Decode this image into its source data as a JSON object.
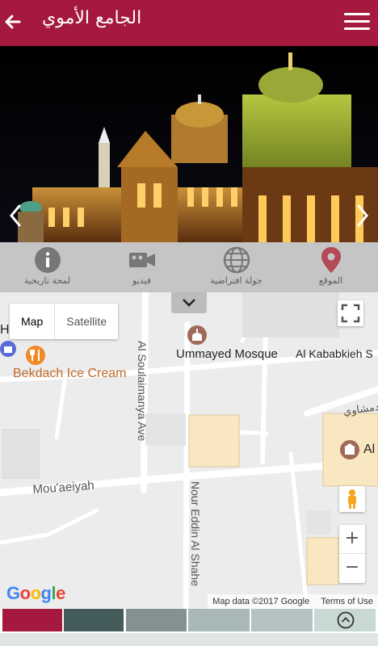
{
  "header": {
    "title": "الجامع الأموي",
    "back_icon": "back-arrow-icon",
    "menu_icon": "hamburger-menu-icon",
    "color": "#a4193d"
  },
  "hero": {
    "prev_icon": "chevron-left-icon",
    "next_icon": "chevron-right-icon"
  },
  "actions": [
    {
      "label": "لمحة تاريخية",
      "icon": "info-icon"
    },
    {
      "label": "فيديو",
      "icon": "video-camera-icon"
    },
    {
      "label": "جولة افتراضية",
      "icon": "globe-icon"
    },
    {
      "label": "الموقع",
      "icon": "map-pin-icon",
      "color": "#b24a57"
    }
  ],
  "map": {
    "type_map": "Map",
    "type_satellite": "Satellite",
    "labels": {
      "mosque": "Ummayed Mosque",
      "street_kabakbieh": "Al Kababkieh S",
      "ice_cream": "Bekdach Ice Cream",
      "soulaimanya": "Al Soulaimanya Ave",
      "mouaeiyah": "Mou'aeiyah",
      "nour_eddin": "Nour Eddin Al Shahe",
      "arabic_street": "دمشاوي",
      "al_partial": "Al",
      "h_partial": "H"
    },
    "attribution": "Map data ©2017 Google",
    "terms": "Terms of Use",
    "logo": "Google",
    "zoom_in": "+",
    "zoom_out": "−"
  },
  "footer": {
    "swatches": [
      "#a4193d",
      "#435b5b",
      "#859191",
      "#a8b8b8",
      "#b4c2c2",
      "#c8d8d4"
    ],
    "up_icon": "chevron-up-circle-icon"
  }
}
